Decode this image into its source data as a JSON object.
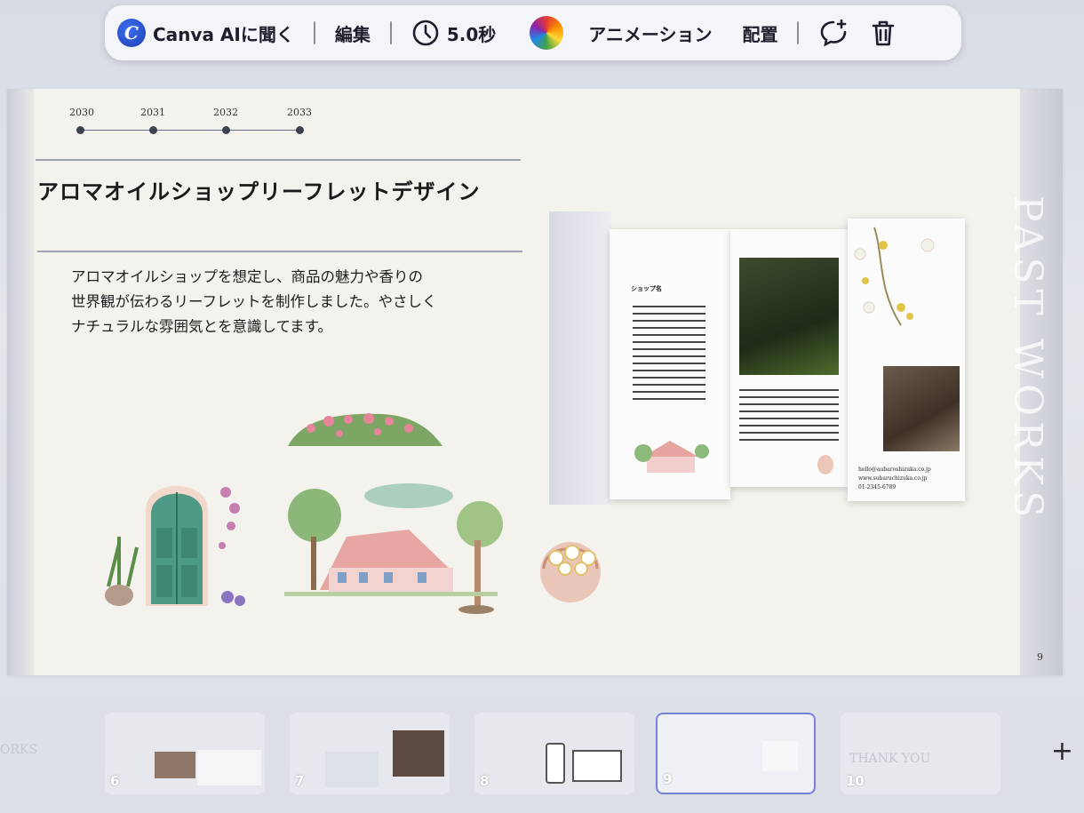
{
  "toolbar": {
    "ai_label": "Canva AIに聞く",
    "edit_label": "編集",
    "duration_label": "5.0秒",
    "animation_label": "アニメーション",
    "arrange_label": "配置",
    "icons": [
      "canva-logo-icon",
      "clock-icon",
      "color-wheel-icon",
      "comment-add-icon",
      "trash-icon"
    ]
  },
  "slide": {
    "timeline_years": [
      "2030",
      "2031",
      "2032",
      "2033"
    ],
    "title": "アロマオイルショップリーフレットデザイン",
    "description_lines": [
      "アロマオイルショップを想定し、商品の魅力や香りの",
      "世界観が伝わるリーフレットを制作しました。やさしく",
      "ナチュラルな雰囲気とを意識してます。"
    ],
    "vertical_text": "PAST WORKS",
    "page_number": "9",
    "leaflet": {
      "heading": "ショップ名",
      "contact_lines": [
        "hello@aubaroshizuka.co.jp",
        "www.subaruchizuka.co.jp",
        "01-2345-6789"
      ]
    }
  },
  "thumbnails": [
    {
      "number": "6",
      "text": ""
    },
    {
      "number": "7",
      "text": ""
    },
    {
      "number": "8",
      "text": ""
    },
    {
      "number": "9",
      "text": "",
      "active": true
    },
    {
      "number": "10",
      "text": "THANK YOU"
    }
  ],
  "thumb_left_fragment": "ORKS",
  "add_page_label": "+"
}
